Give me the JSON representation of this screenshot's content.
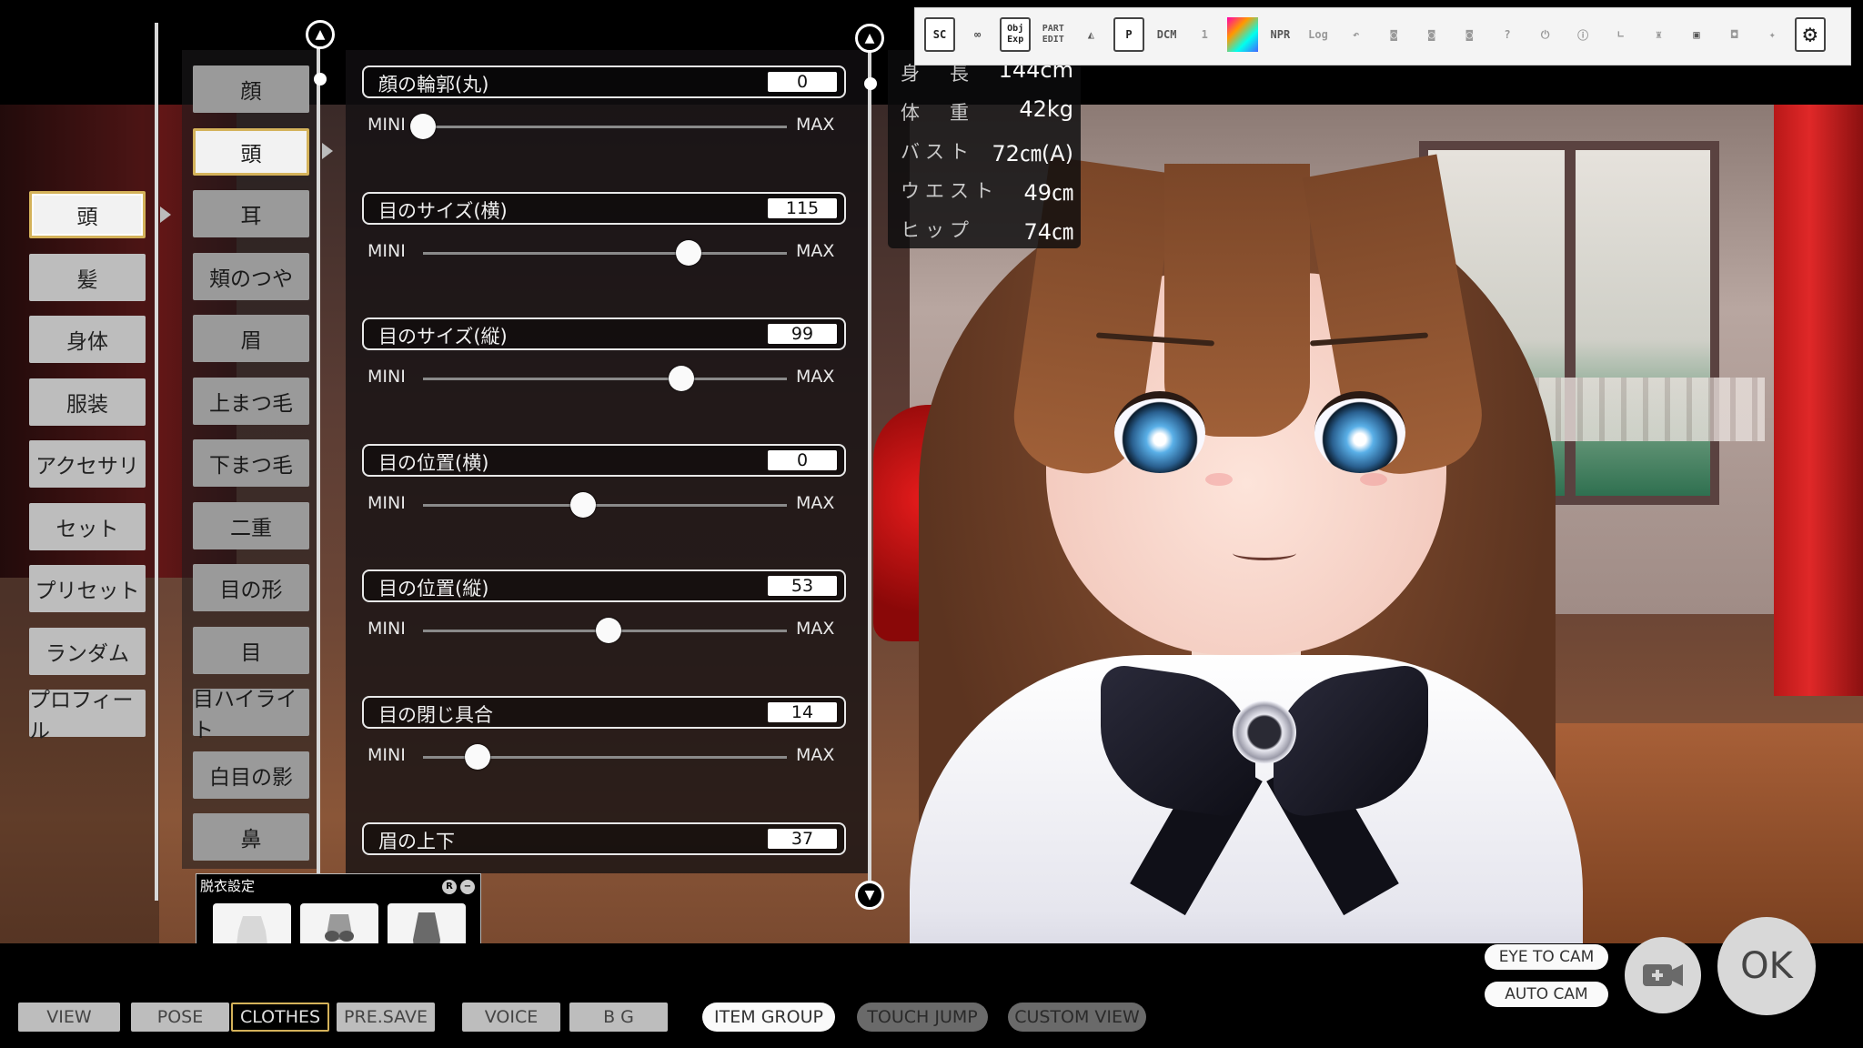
{
  "categories": [
    "頭",
    "髪",
    "身体",
    "服装",
    "アクセサリ",
    "セット",
    "プリセット",
    "ランダム",
    "プロフィール"
  ],
  "subcategories": [
    "顔",
    "頭",
    "耳",
    "頬のつや",
    "眉",
    "上まつ毛",
    "下まつ毛",
    "二重",
    "目の形",
    "目",
    "目ハイライト",
    "白目の影",
    "鼻"
  ],
  "sliders": [
    {
      "label": "顔の輪郭(丸)",
      "value": "0",
      "ratio": 0.0
    },
    {
      "label": "目のサイズ(横)",
      "value": "115",
      "ratio": 0.73
    },
    {
      "label": "目のサイズ(縦)",
      "value": "99",
      "ratio": 0.71
    },
    {
      "label": "目の位置(横)",
      "value": "0",
      "ratio": 0.44
    },
    {
      "label": "目の位置(縦)",
      "value": "53",
      "ratio": 0.51
    },
    {
      "label": "目の閉じ具合",
      "value": "14",
      "ratio": 0.15
    },
    {
      "label": "眉の上下",
      "value": "37",
      "ratio": null
    }
  ],
  "slider_min_label": "MINI",
  "slider_max_label": "MAX",
  "stats": [
    {
      "label": "身　長",
      "value": "144cm"
    },
    {
      "label": "体　重",
      "value": "42kg"
    },
    {
      "label": "バスト",
      "value": "72㎝(A)"
    },
    {
      "label": "ウエスト",
      "value": "49㎝"
    },
    {
      "label": "ヒップ",
      "value": "74㎝"
    }
  ],
  "toolbar": [
    {
      "icon": "sc-icon",
      "text": "SC",
      "style": "boxed"
    },
    {
      "icon": "vr-goggles-icon",
      "text": "∞",
      "style": "plain"
    },
    {
      "icon": "obj-exp-icon",
      "text": "Obj Exp",
      "style": "boxed"
    },
    {
      "icon": "part-edit-icon",
      "text": "PART EDIT",
      "style": "plain"
    },
    {
      "icon": "3d-cube-icon",
      "text": "◭",
      "style": "plain"
    },
    {
      "icon": "p-icon",
      "text": "P",
      "style": "boxed"
    },
    {
      "icon": "dcm-icon",
      "text": "DCM",
      "style": "plain"
    },
    {
      "icon": "one-icon",
      "text": "1",
      "style": "faded"
    },
    {
      "icon": "color-palette-icon",
      "text": "",
      "style": "gradient"
    },
    {
      "icon": "npr-icon",
      "text": "NPR",
      "style": "plain"
    },
    {
      "icon": "log-icon",
      "text": "Log",
      "style": "faded"
    },
    {
      "icon": "undo-icon",
      "text": "↶",
      "style": "faded"
    },
    {
      "icon": "camera-settings-icon",
      "text": "◙",
      "style": "faded"
    },
    {
      "icon": "camera-gear-icon",
      "text": "◙",
      "style": "faded"
    },
    {
      "icon": "camera-icon",
      "text": "◙",
      "style": "faded"
    },
    {
      "icon": "help-icon",
      "text": "?",
      "style": "faded"
    },
    {
      "icon": "power-icon",
      "text": "⏻",
      "style": "faded"
    },
    {
      "icon": "info-icon",
      "text": "ⓘ",
      "style": "faded"
    },
    {
      "icon": "axis-icon",
      "text": "∟",
      "style": "faded"
    },
    {
      "icon": "basket-icon",
      "text": "♜",
      "style": "faded"
    },
    {
      "icon": "photo-icon",
      "text": "▣",
      "style": "plain"
    },
    {
      "icon": "capture-icon",
      "text": "◘",
      "style": "faded"
    },
    {
      "icon": "plugin-icon",
      "text": "✦",
      "style": "faded"
    },
    {
      "icon": "settings-gear-icon",
      "text": "⚙",
      "style": "boxed"
    }
  ],
  "undress": {
    "title": "脱衣設定",
    "r_label": "R",
    "minus_label": "−"
  },
  "bottom_left": [
    {
      "label": "VIEW",
      "active": false
    },
    {
      "label": "POSE",
      "active": false
    },
    {
      "label": "CLOTHES",
      "active": true
    },
    {
      "label": "PRE.SAVE",
      "active": false
    },
    {
      "label": "VOICE",
      "active": false
    },
    {
      "label": "B G",
      "active": false
    }
  ],
  "bottom_pills": [
    {
      "label": "ITEM GROUP",
      "style": "white"
    },
    {
      "label": "TOUCH JUMP",
      "style": "gray"
    },
    {
      "label": "CUSTOM VIEW",
      "style": "gray"
    }
  ],
  "cam_buttons": {
    "eye_to_cam": "EYE TO CAM",
    "auto_cam": "AUTO CAM"
  },
  "ok_label": "OK",
  "colors": {
    "accent_gold": "#d4b25a",
    "button_gray": "#bdbdbd",
    "panel_dark": "#121012"
  }
}
